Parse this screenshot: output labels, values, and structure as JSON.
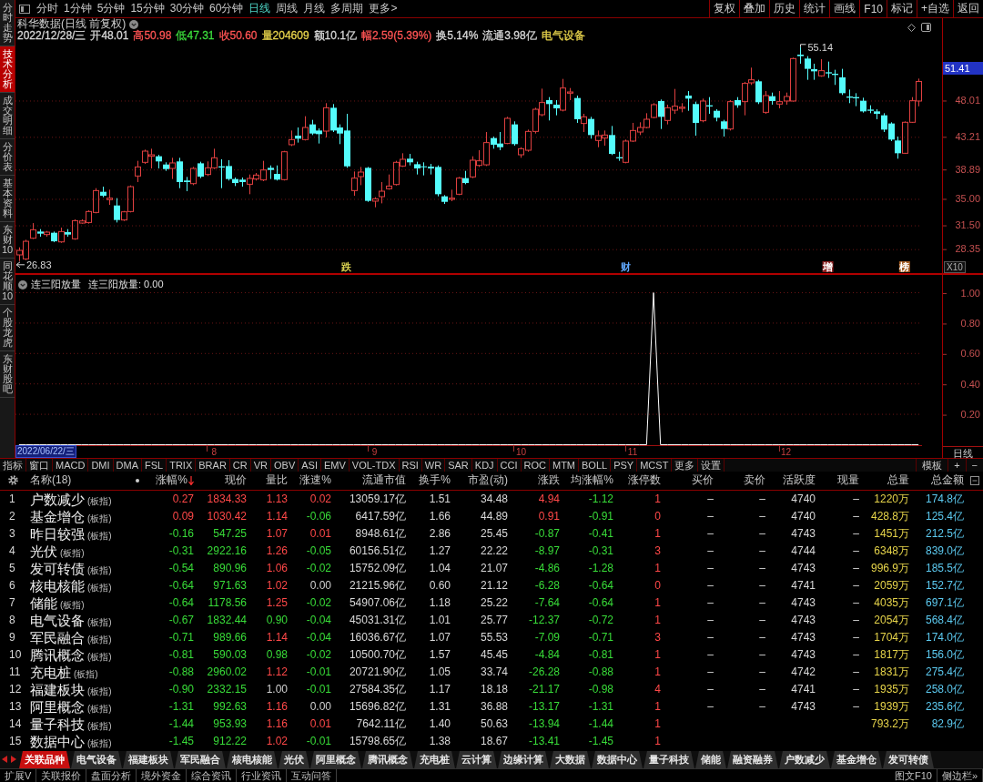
{
  "sidebar": {
    "items": [
      {
        "label": "分时走势",
        "selected": false
      },
      {
        "label": "技术分析",
        "selected": true
      },
      {
        "label": "成交明细",
        "selected": false
      },
      {
        "label": "分价表",
        "selected": false
      },
      {
        "label": "基本资料",
        "selected": false
      },
      {
        "label": "东财10",
        "selected": false
      },
      {
        "label": "同花顺10",
        "selected": false
      },
      {
        "label": "个股龙虎",
        "selected": false
      },
      {
        "label": "东财股吧",
        "selected": false
      }
    ]
  },
  "toolbar": {
    "periods": [
      {
        "label": "分时",
        "selected": false
      },
      {
        "label": "1分钟",
        "selected": false
      },
      {
        "label": "5分钟",
        "selected": false
      },
      {
        "label": "15分钟",
        "selected": false
      },
      {
        "label": "30分钟",
        "selected": false
      },
      {
        "label": "60分钟",
        "selected": false
      },
      {
        "label": "日线",
        "selected": true
      },
      {
        "label": "周线",
        "selected": false
      },
      {
        "label": "月线",
        "selected": false
      },
      {
        "label": "多周期",
        "selected": false
      },
      {
        "label": "更多>",
        "selected": false
      }
    ],
    "buttons": [
      "复权",
      "叠加",
      "历史",
      "统计",
      "画线",
      "F10",
      "标记",
      "+自选",
      "返回"
    ]
  },
  "stock_header": {
    "title": "科华数据(日线 前复权)",
    "quote": [
      {
        "text": "2022/12/28/三",
        "color": "#d8d8d8"
      },
      {
        "text": "开48.01",
        "color": "#d8d8d8"
      },
      {
        "text": "高50.98",
        "color": "#ff5454"
      },
      {
        "text": "低47.31",
        "color": "#3cdc3c"
      },
      {
        "text": "收50.60",
        "color": "#ff5454"
      },
      {
        "text": "量204609",
        "color": "#e8d44c"
      },
      {
        "text": "额10.1亿",
        "color": "#d8d8d8"
      },
      {
        "text": "幅2.59(5.39%)",
        "color": "#ff5454"
      },
      {
        "text": "换5.14%",
        "color": "#d8d8d8"
      },
      {
        "text": "流通3.98亿",
        "color": "#d8d8d8"
      },
      {
        "text": "电气设备",
        "color": "#e8d44c"
      }
    ]
  },
  "main_chart": {
    "current_price": "51.41",
    "high_label": "55.14",
    "low_label": "26.83",
    "event_marks": [
      {
        "text": "跌",
        "color": "#d8d050",
        "boxed": false
      },
      {
        "text": "财",
        "color": "#60a8ff",
        "boxed": false
      },
      {
        "text": "增",
        "color": "#8b2020",
        "boxed": true
      },
      {
        "text": "榜",
        "color": "#a05a20",
        "boxed": true
      }
    ],
    "zoom_button": "X10",
    "chart_data": {
      "type": "candlestick",
      "categories": [
        null,
        null,
        null,
        null,
        null,
        null,
        null,
        null,
        null,
        null,
        null,
        null,
        null,
        null,
        null,
        null,
        null,
        null,
        null,
        null,
        null,
        null,
        null,
        null,
        null,
        null,
        null,
        null,
        null,
        null,
        null,
        null,
        null,
        null,
        null,
        null,
        null,
        null,
        null,
        null,
        null,
        null,
        null,
        null,
        null,
        null,
        null,
        null,
        null,
        null,
        null,
        null,
        null,
        null,
        null,
        null,
        null,
        null,
        null,
        null,
        null,
        null,
        null,
        null,
        null,
        null,
        null,
        null,
        null,
        null,
        null,
        null,
        null,
        null,
        null,
        null,
        null,
        null,
        null,
        null,
        null,
        null,
        null,
        null,
        null,
        null,
        null,
        null,
        null,
        null,
        null,
        null,
        null,
        null,
        null,
        null,
        null,
        null,
        null,
        null,
        null,
        null,
        null,
        null,
        null,
        null,
        null,
        null,
        null,
        null,
        null,
        null,
        null,
        null,
        null,
        null,
        null,
        null,
        null,
        null,
        null,
        null,
        null,
        null,
        null,
        null,
        null,
        null,
        null,
        null
      ],
      "ohlc": [
        [
          27.65,
          28.65,
          26.83,
          28.25
        ],
        [
          27.12,
          29.65,
          26.96,
          29.45
        ],
        [
          29.86,
          31.86,
          29.76,
          30.98
        ],
        [
          30.74,
          31.06,
          30.06,
          30.46
        ],
        [
          30.34,
          30.82,
          30.06,
          30.66
        ],
        [
          30.58,
          30.74,
          29.33,
          29.45
        ],
        [
          29.37,
          31.26,
          29.25,
          30.74
        ],
        [
          30.66,
          31.06,
          30.06,
          30.34
        ],
        [
          29.78,
          32.35,
          29.65,
          32.18
        ],
        [
          31.86,
          32.35,
          31.78,
          32.14
        ],
        [
          31.94,
          33.55,
          31.78,
          33.39
        ],
        [
          33.27,
          36.48,
          33.15,
          36.16
        ],
        [
          36.0,
          36.68,
          35.28,
          35.48
        ],
        [
          34.96,
          36.28,
          34.27,
          35.16
        ],
        [
          34.19,
          35.16,
          31.94,
          32.27
        ],
        [
          32.27,
          33.47,
          32.14,
          33.35
        ],
        [
          33.39,
          36.84,
          33.27,
          36.68
        ],
        [
          38.09,
          40.1,
          37.29,
          39.29
        ],
        [
          39.9,
          41.58,
          39.69,
          41.38
        ],
        [
          40.7,
          41.7,
          39.09,
          40.9
        ],
        [
          40.7,
          40.9,
          39.09,
          40.02
        ],
        [
          39.61,
          39.9,
          38.77,
          39.01
        ],
        [
          39.09,
          40.5,
          37.69,
          39.82
        ],
        [
          40.02,
          40.5,
          36.48,
          37.29
        ],
        [
          37.49,
          37.97,
          36.08,
          37.29
        ],
        [
          37.08,
          39.29,
          36.88,
          39.09
        ],
        [
          39.77,
          39.98,
          37.81,
          38.01
        ],
        [
          38.29,
          40.02,
          38.09,
          39.17
        ],
        [
          39.17,
          41.7,
          39.01,
          40.5
        ],
        [
          39.37,
          40.3,
          36.48,
          39.21
        ],
        [
          39.41,
          40.18,
          37.49,
          37.69
        ],
        [
          37.69,
          37.89,
          36.76,
          37.16
        ],
        [
          37.61,
          37.89,
          36.68,
          37.29
        ],
        [
          37.0,
          38.29,
          35.68,
          37.77
        ],
        [
          37.69,
          38.49,
          37.49,
          38.21
        ],
        [
          37.57,
          40.1,
          37.41,
          38.89
        ],
        [
          39.17,
          39.49,
          37.69,
          38.89
        ],
        [
          38.37,
          39.49,
          37.49,
          37.61
        ],
        [
          37.61,
          41.42,
          37.49,
          41.3
        ],
        [
          42.23,
          44.11,
          42.06,
          42.91
        ],
        [
          43.43,
          44.51,
          42.51,
          43.03
        ],
        [
          42.91,
          46.0,
          42.79,
          44.51
        ],
        [
          44.92,
          45.52,
          43.51,
          43.71
        ],
        [
          44.11,
          44.39,
          42.39,
          43.63
        ],
        [
          44.03,
          47.73,
          43.19,
          47.12
        ],
        [
          47.12,
          47.61,
          43.91,
          44.11
        ],
        [
          44.51,
          44.92,
          42.31,
          43.71
        ],
        [
          44.11,
          46.32,
          39.17,
          39.37
        ],
        [
          36.16,
          38.69,
          35.48,
          37.81
        ],
        [
          38.01,
          39.29,
          36.88,
          38.61
        ],
        [
          39.17,
          39.29,
          34.67,
          34.8
        ],
        [
          34.76,
          35.28,
          33.95,
          35.08
        ],
        [
          35.36,
          37.29,
          34.47,
          36.08
        ],
        [
          36.4,
          38.29,
          36.28,
          36.76
        ],
        [
          36.96,
          40.1,
          36.84,
          39.9
        ],
        [
          39.41,
          41.1,
          39.29,
          40.3
        ],
        [
          40.38,
          41.02,
          39.49,
          39.9
        ],
        [
          39.65,
          39.98,
          38.29,
          39.09
        ],
        [
          39.37,
          39.9,
          38.17,
          39.29
        ],
        [
          39.33,
          39.69,
          38.29,
          39.09
        ],
        [
          39.29,
          39.49,
          35.4,
          35.68
        ],
        [
          35.4,
          35.56,
          34.39,
          34.67
        ],
        [
          35.0,
          36.28,
          34.76,
          35.16
        ],
        [
          35.68,
          37.97,
          35.56,
          37.81
        ],
        [
          37.81,
          38.77,
          37.0,
          37.16
        ],
        [
          37.97,
          40.7,
          37.81,
          40.18
        ],
        [
          39.49,
          41.5,
          39.29,
          40.1
        ],
        [
          39.57,
          43.91,
          39.41,
          42.51
        ],
        [
          43.11,
          43.31,
          41.7,
          42.23
        ],
        [
          42.39,
          43.91,
          41.5,
          41.9
        ],
        [
          42.39,
          45.92,
          42.31,
          45.72
        ],
        [
          44.92,
          45.32,
          42.1,
          42.31
        ],
        [
          40.9,
          41.9,
          40.5,
          41.7
        ],
        [
          41.5,
          44.23,
          41.3,
          43.99
        ],
        [
          43.99,
          47.12,
          43.71,
          46.92
        ],
        [
          46.2,
          49.65,
          46.0,
          47.81
        ],
        [
          48.13,
          48.53,
          45.44,
          47.61
        ],
        [
          47.53,
          48.13,
          46.12,
          47.04
        ],
        [
          46.8,
          50.94,
          46.64,
          49.73
        ],
        [
          49.05,
          49.73,
          48.13,
          49.21
        ],
        [
          48.41,
          48.73,
          45.12,
          45.6
        ],
        [
          45.04,
          46.32,
          43.91,
          45.92
        ],
        [
          45.64,
          45.92,
          43.03,
          43.51
        ],
        [
          42.79,
          44.11,
          41.9,
          43.43
        ],
        [
          43.11,
          44.11,
          42.1,
          43.51
        ],
        [
          43.51,
          44.71,
          40.86,
          41.02
        ],
        [
          40.58,
          41.3,
          40.1,
          40.42
        ],
        [
          39.9,
          42.91,
          39.77,
          42.71
        ],
        [
          42.71,
          45.12,
          42.59,
          44.11
        ],
        [
          43.91,
          45.2,
          43.51,
          44.51
        ],
        [
          44.51,
          46.4,
          44.39,
          45.6
        ],
        [
          45.84,
          47.73,
          45.72,
          47.53
        ],
        [
          48.01,
          48.21,
          44.31,
          45.92
        ],
        [
          45.44,
          47.53,
          44.92,
          47.12
        ],
        [
          46.8,
          49.61,
          46.32,
          47.33
        ],
        [
          47.04,
          47.73,
          46.52,
          47.2
        ],
        [
          48.73,
          49.33,
          46.72,
          48.33
        ],
        [
          47.61,
          47.93,
          43.43,
          45.12
        ],
        [
          45.4,
          48.33,
          45.2,
          48.01
        ],
        [
          47.45,
          48.53,
          46.32,
          47.29
        ],
        [
          46.72,
          46.92,
          45.32,
          45.8
        ],
        [
          45.32,
          45.52,
          43.31,
          44.31
        ],
        [
          44.31,
          48.13,
          44.11,
          47.93
        ],
        [
          48.13,
          48.53,
          47.12,
          47.45
        ],
        [
          47.93,
          50.54,
          46.12,
          50.34
        ],
        [
          50.42,
          52.43,
          50.14,
          50.82
        ],
        [
          50.62,
          50.82,
          47.61,
          47.85
        ],
        [
          46.52,
          49.33,
          46.32,
          48.73
        ],
        [
          48.65,
          49.13,
          47.53,
          48.01
        ],
        [
          47.61,
          49.33,
          47.04,
          47.93
        ],
        [
          48.01,
          49.13,
          47.53,
          48.61
        ],
        [
          48.01,
          53.75,
          47.93,
          53.63
        ],
        [
          54.15,
          55.14,
          52.95,
          53.95
        ],
        [
          53.63,
          53.95,
          50.82,
          52.27
        ],
        [
          52.23,
          52.95,
          50.82,
          51.94
        ],
        [
          51.34,
          53.55,
          51.22,
          52.03
        ],
        [
          51.82,
          53.23,
          51.06,
          51.66
        ],
        [
          51.62,
          52.15,
          50.14,
          51.46
        ],
        [
          51.14,
          52.27,
          48.81,
          49.05
        ],
        [
          48.61,
          49.53,
          47.73,
          48.45
        ],
        [
          48.53,
          49.05,
          47.33,
          48.37
        ],
        [
          48.05,
          48.45,
          46.48,
          46.64
        ],
        [
          46.88,
          47.45,
          46.4,
          46.72
        ],
        [
          46.64,
          46.92,
          45.6,
          46.32
        ],
        [
          46.12,
          46.4,
          43.91,
          44.23
        ],
        [
          45.04,
          45.2,
          42.71,
          42.91
        ],
        [
          42.79,
          43.31,
          40.38,
          41.1
        ],
        [
          41.1,
          45.32,
          41.02,
          45.2
        ],
        [
          45.2,
          48.53,
          45.12,
          48.05
        ],
        [
          48.01,
          50.98,
          47.31,
          50.6
        ]
      ],
      "ylim": [
        25.12,
        58.97
      ],
      "yticks": [
        {
          "value": 48.01,
          "label": "48.01"
        },
        {
          "value": 43.21,
          "label": "43.21"
        },
        {
          "value": 38.89,
          "label": "38.89"
        },
        {
          "value": 35,
          "label": "35.00"
        },
        {
          "value": 31.5,
          "label": "31.50"
        },
        {
          "value": 28.35,
          "label": "28.35"
        }
      ],
      "grid": true
    }
  },
  "indicator": {
    "legend": "连三阳放量: 0.00",
    "cursor_date": "2022/06/22/三",
    "period_label": "日线",
    "chart_data": {
      "type": "line",
      "title": "连三阳放量",
      "categories": [
        null,
        null,
        null,
        null,
        null,
        null,
        null,
        null,
        null,
        null,
        null,
        null,
        null,
        null,
        null,
        null,
        null,
        null,
        null,
        null,
        null,
        null,
        null,
        null,
        null,
        null,
        null,
        null,
        "8",
        null,
        null,
        null,
        null,
        null,
        null,
        null,
        null,
        null,
        null,
        null,
        null,
        null,
        null,
        null,
        null,
        null,
        null,
        null,
        null,
        null,
        null,
        "9",
        null,
        null,
        null,
        null,
        null,
        null,
        null,
        null,
        null,
        null,
        null,
        null,
        null,
        null,
        null,
        null,
        null,
        null,
        null,
        null,
        "10",
        null,
        null,
        null,
        null,
        null,
        null,
        null,
        null,
        null,
        null,
        null,
        null,
        null,
        null,
        null,
        "11",
        null,
        null,
        null,
        null,
        null,
        null,
        null,
        null,
        null,
        null,
        null,
        null,
        null,
        null,
        null,
        null,
        null,
        null,
        null,
        null,
        null,
        "12",
        null,
        null,
        null,
        null,
        null,
        null,
        null,
        null,
        null,
        null,
        null,
        null,
        null,
        null,
        null,
        null,
        null,
        null,
        null
      ],
      "ylim": [
        -0.087,
        1.123
      ],
      "yticks": [
        {
          "value": 1,
          "label": "1.00"
        },
        {
          "value": 0.8,
          "label": "0.80"
        },
        {
          "value": 0.6,
          "label": "0.60"
        },
        {
          "value": 0.4,
          "label": "0.40"
        },
        {
          "value": 0.2,
          "label": "0.20"
        }
      ],
      "grid": true,
      "series": [
        {
          "color": "#ffffff",
          "values": [
            0,
            0,
            0,
            0,
            0,
            0,
            0,
            0,
            0,
            0,
            0,
            0,
            0,
            0,
            0,
            0,
            0,
            0,
            0,
            0,
            0,
            0,
            0,
            0,
            0,
            0,
            0,
            0,
            0,
            0,
            0,
            0,
            0,
            0,
            0,
            0,
            0,
            0,
            0,
            0,
            0,
            0,
            0,
            0,
            0,
            0,
            0,
            0,
            0,
            0,
            0,
            0,
            0,
            0,
            0,
            0,
            0,
            0,
            0,
            0,
            0,
            0,
            0,
            0,
            0,
            0,
            0,
            0,
            0,
            0,
            0,
            0,
            0,
            0,
            0,
            0,
            0,
            0,
            0,
            0,
            0,
            0,
            0,
            0,
            0,
            0,
            0,
            0,
            0,
            0,
            0,
            1,
            0,
            0,
            0,
            0,
            0,
            0,
            0,
            0,
            0,
            0,
            0,
            0,
            0,
            0,
            0,
            0,
            0,
            0,
            0,
            0,
            0,
            0,
            0,
            0,
            0,
            0,
            0,
            0,
            0,
            0,
            0,
            0,
            0,
            0,
            0,
            0,
            0,
            0
          ]
        }
      ]
    }
  },
  "indicator_bar": {
    "tabs": [
      "指标",
      "窗口",
      "MACD",
      "DMI",
      "DMA",
      "FSL",
      "TRIX",
      "BRAR",
      "CR",
      "VR",
      "OBV",
      "ASI",
      "EMV",
      "VOL-TDX",
      "RSI",
      "WR",
      "SAR",
      "KDJ",
      "CCI",
      "ROC",
      "MTM",
      "BOLL",
      "PSY",
      "MCST",
      "更多",
      "设置"
    ],
    "tools": [
      "模板",
      "+",
      "−"
    ]
  },
  "table": {
    "columns": [
      {
        "label": "名称(18)",
        "sorted": false
      },
      {
        "label": "涨幅%",
        "sorted": true
      },
      {
        "label": "现价",
        "sorted": false
      },
      {
        "label": "量比",
        "sorted": false
      },
      {
        "label": "涨速%",
        "sorted": false
      },
      {
        "label": "流通市值",
        "sorted": false
      },
      {
        "label": "换手%",
        "sorted": false
      },
      {
        "label": "市盈(动)",
        "sorted": false
      },
      {
        "label": "涨跌",
        "sorted": false
      },
      {
        "label": "均涨幅%",
        "sorted": false
      },
      {
        "label": "涨停数",
        "sorted": false
      },
      {
        "label": "买价",
        "sorted": false
      },
      {
        "label": "卖价",
        "sorted": false
      },
      {
        "label": "活跃度",
        "sorted": false
      },
      {
        "label": "现量",
        "sorted": false
      },
      {
        "label": "总量",
        "sorted": false
      },
      {
        "label": "总金额",
        "sorted": false
      }
    ],
    "rows": [
      {
        "no": "1",
        "name": "户数减少",
        "tag": "(板指)",
        "change_pct": {
          "text": "0.27",
          "color": "#ff4848"
        },
        "price": {
          "text": "1834.33",
          "color": "#ff4848"
        },
        "volume_ratio": {
          "text": "1.13",
          "color": "#ff4848"
        },
        "speed": {
          "text": "0.02",
          "color": "#ff4848"
        },
        "float_value": "13059.17亿",
        "turnover": "1.51",
        "pe": "34.48",
        "change": {
          "text": "4.94",
          "color": "#ff4848"
        },
        "avg_change": {
          "text": "-1.12",
          "color": "#38dc38"
        },
        "limit_ups": "1",
        "bid": "–",
        "ask": "–",
        "activity": "4740",
        "last_volume": "–",
        "volume": "1220万",
        "amount": "174.8亿"
      },
      {
        "no": "2",
        "name": "基金增仓",
        "tag": "(板指)",
        "change_pct": {
          "text": "0.09",
          "color": "#ff4848"
        },
        "price": {
          "text": "1030.42",
          "color": "#ff4848"
        },
        "volume_ratio": {
          "text": "1.14",
          "color": "#ff4848"
        },
        "speed": {
          "text": "-0.06",
          "color": "#38dc38"
        },
        "float_value": "6417.59亿",
        "turnover": "1.66",
        "pe": "44.89",
        "change": {
          "text": "0.91",
          "color": "#ff4848"
        },
        "avg_change": {
          "text": "-0.91",
          "color": "#38dc38"
        },
        "limit_ups": "0",
        "bid": "–",
        "ask": "–",
        "activity": "4740",
        "last_volume": "–",
        "volume": "428.8万",
        "amount": "125.4亿"
      },
      {
        "no": "3",
        "name": "昨日较强",
        "tag": "(板指)",
        "change_pct": {
          "text": "-0.16",
          "color": "#38dc38"
        },
        "price": {
          "text": "547.25",
          "color": "#38dc38"
        },
        "volume_ratio": {
          "text": "1.07",
          "color": "#ff4848"
        },
        "speed": {
          "text": "0.01",
          "color": "#ff4848"
        },
        "float_value": "8948.61亿",
        "turnover": "2.86",
        "pe": "25.45",
        "change": {
          "text": "-0.87",
          "color": "#38dc38"
        },
        "avg_change": {
          "text": "-0.41",
          "color": "#38dc38"
        },
        "limit_ups": "1",
        "bid": "–",
        "ask": "–",
        "activity": "4743",
        "last_volume": "–",
        "volume": "1451万",
        "amount": "212.5亿"
      },
      {
        "no": "4",
        "name": "光伏",
        "tag": "(板指)",
        "change_pct": {
          "text": "-0.31",
          "color": "#38dc38"
        },
        "price": {
          "text": "2922.16",
          "color": "#38dc38"
        },
        "volume_ratio": {
          "text": "1.26",
          "color": "#ff4848"
        },
        "speed": {
          "text": "-0.05",
          "color": "#38dc38"
        },
        "float_value": "60156.51亿",
        "turnover": "1.27",
        "pe": "22.22",
        "change": {
          "text": "-8.97",
          "color": "#38dc38"
        },
        "avg_change": {
          "text": "-0.31",
          "color": "#38dc38"
        },
        "limit_ups": "3",
        "bid": "–",
        "ask": "–",
        "activity": "4744",
        "last_volume": "–",
        "volume": "6348万",
        "amount": "839.0亿"
      },
      {
        "no": "5",
        "name": "发可转债",
        "tag": "(板指)",
        "change_pct": {
          "text": "-0.54",
          "color": "#38dc38"
        },
        "price": {
          "text": "890.96",
          "color": "#38dc38"
        },
        "volume_ratio": {
          "text": "1.06",
          "color": "#ff4848"
        },
        "speed": {
          "text": "-0.02",
          "color": "#38dc38"
        },
        "float_value": "15752.09亿",
        "turnover": "1.04",
        "pe": "21.07",
        "change": {
          "text": "-4.86",
          "color": "#38dc38"
        },
        "avg_change": {
          "text": "-1.28",
          "color": "#38dc38"
        },
        "limit_ups": "1",
        "bid": "–",
        "ask": "–",
        "activity": "4743",
        "last_volume": "–",
        "volume": "996.9万",
        "amount": "185.5亿"
      },
      {
        "no": "6",
        "name": "核电核能",
        "tag": "(板指)",
        "change_pct": {
          "text": "-0.64",
          "color": "#38dc38"
        },
        "price": {
          "text": "971.63",
          "color": "#38dc38"
        },
        "volume_ratio": {
          "text": "1.02",
          "color": "#ff4848"
        },
        "speed": {
          "text": "0.00",
          "color": "#d0d0d0"
        },
        "float_value": "21215.96亿",
        "turnover": "0.60",
        "pe": "21.12",
        "change": {
          "text": "-6.28",
          "color": "#38dc38"
        },
        "avg_change": {
          "text": "-0.64",
          "color": "#38dc38"
        },
        "limit_ups": "0",
        "bid": "–",
        "ask": "–",
        "activity": "4741",
        "last_volume": "–",
        "volume": "2059万",
        "amount": "152.7亿"
      },
      {
        "no": "7",
        "name": "储能",
        "tag": "(板指)",
        "change_pct": {
          "text": "-0.64",
          "color": "#38dc38"
        },
        "price": {
          "text": "1178.56",
          "color": "#38dc38"
        },
        "volume_ratio": {
          "text": "1.25",
          "color": "#ff4848"
        },
        "speed": {
          "text": "-0.02",
          "color": "#38dc38"
        },
        "float_value": "54907.06亿",
        "turnover": "1.18",
        "pe": "25.22",
        "change": {
          "text": "-7.64",
          "color": "#38dc38"
        },
        "avg_change": {
          "text": "-0.64",
          "color": "#38dc38"
        },
        "limit_ups": "1",
        "bid": "–",
        "ask": "–",
        "activity": "4743",
        "last_volume": "–",
        "volume": "4035万",
        "amount": "697.1亿"
      },
      {
        "no": "8",
        "name": "电气设备",
        "tag": "(板指)",
        "change_pct": {
          "text": "-0.67",
          "color": "#38dc38"
        },
        "price": {
          "text": "1832.44",
          "color": "#38dc38"
        },
        "volume_ratio": {
          "text": "0.90",
          "color": "#38dc38"
        },
        "speed": {
          "text": "-0.04",
          "color": "#38dc38"
        },
        "float_value": "45031.31亿",
        "turnover": "1.01",
        "pe": "25.77",
        "change": {
          "text": "-12.37",
          "color": "#38dc38"
        },
        "avg_change": {
          "text": "-0.72",
          "color": "#38dc38"
        },
        "limit_ups": "1",
        "bid": "–",
        "ask": "–",
        "activity": "4743",
        "last_volume": "–",
        "volume": "2054万",
        "amount": "568.4亿"
      },
      {
        "no": "9",
        "name": "军民融合",
        "tag": "(板指)",
        "change_pct": {
          "text": "-0.71",
          "color": "#38dc38"
        },
        "price": {
          "text": "989.66",
          "color": "#38dc38"
        },
        "volume_ratio": {
          "text": "1.14",
          "color": "#ff4848"
        },
        "speed": {
          "text": "-0.04",
          "color": "#38dc38"
        },
        "float_value": "16036.67亿",
        "turnover": "1.07",
        "pe": "55.53",
        "change": {
          "text": "-7.09",
          "color": "#38dc38"
        },
        "avg_change": {
          "text": "-0.71",
          "color": "#38dc38"
        },
        "limit_ups": "3",
        "bid": "–",
        "ask": "–",
        "activity": "4743",
        "last_volume": "–",
        "volume": "1704万",
        "amount": "174.0亿"
      },
      {
        "no": "10",
        "name": "腾讯概念",
        "tag": "(板指)",
        "change_pct": {
          "text": "-0.81",
          "color": "#38dc38"
        },
        "price": {
          "text": "590.03",
          "color": "#38dc38"
        },
        "volume_ratio": {
          "text": "0.98",
          "color": "#38dc38"
        },
        "speed": {
          "text": "-0.02",
          "color": "#38dc38"
        },
        "float_value": "10500.70亿",
        "turnover": "1.57",
        "pe": "45.45",
        "change": {
          "text": "-4.84",
          "color": "#38dc38"
        },
        "avg_change": {
          "text": "-0.81",
          "color": "#38dc38"
        },
        "limit_ups": "1",
        "bid": "–",
        "ask": "–",
        "activity": "4743",
        "last_volume": "–",
        "volume": "1817万",
        "amount": "156.0亿"
      },
      {
        "no": "11",
        "name": "充电桩",
        "tag": "(板指)",
        "change_pct": {
          "text": "-0.88",
          "color": "#38dc38"
        },
        "price": {
          "text": "2960.02",
          "color": "#38dc38"
        },
        "volume_ratio": {
          "text": "1.12",
          "color": "#ff4848"
        },
        "speed": {
          "text": "-0.01",
          "color": "#38dc38"
        },
        "float_value": "20721.90亿",
        "turnover": "1.05",
        "pe": "33.74",
        "change": {
          "text": "-26.28",
          "color": "#38dc38"
        },
        "avg_change": {
          "text": "-0.88",
          "color": "#38dc38"
        },
        "limit_ups": "1",
        "bid": "–",
        "ask": "–",
        "activity": "4742",
        "last_volume": "–",
        "volume": "1831万",
        "amount": "275.4亿"
      },
      {
        "no": "12",
        "name": "福建板块",
        "tag": "(板指)",
        "change_pct": {
          "text": "-0.90",
          "color": "#38dc38"
        },
        "price": {
          "text": "2332.15",
          "color": "#38dc38"
        },
        "volume_ratio": {
          "text": "1.00",
          "color": "#d0d0d0"
        },
        "speed": {
          "text": "-0.01",
          "color": "#38dc38"
        },
        "float_value": "27584.35亿",
        "turnover": "1.17",
        "pe": "18.18",
        "change": {
          "text": "-21.17",
          "color": "#38dc38"
        },
        "avg_change": {
          "text": "-0.98",
          "color": "#38dc38"
        },
        "limit_ups": "4",
        "bid": "–",
        "ask": "–",
        "activity": "4741",
        "last_volume": "–",
        "volume": "1935万",
        "amount": "258.0亿"
      },
      {
        "no": "13",
        "name": "阿里概念",
        "tag": "(板指)",
        "change_pct": {
          "text": "-1.31",
          "color": "#38dc38"
        },
        "price": {
          "text": "992.63",
          "color": "#38dc38"
        },
        "volume_ratio": {
          "text": "1.16",
          "color": "#ff4848"
        },
        "speed": {
          "text": "0.00",
          "color": "#d0d0d0"
        },
        "float_value": "15696.82亿",
        "turnover": "1.31",
        "pe": "36.88",
        "change": {
          "text": "-13.17",
          "color": "#38dc38"
        },
        "avg_change": {
          "text": "-1.31",
          "color": "#38dc38"
        },
        "limit_ups": "1",
        "bid": "–",
        "ask": "–",
        "activity": "4743",
        "last_volume": "–",
        "volume": "1939万",
        "amount": "235.6亿"
      },
      {
        "no": "14",
        "name": "量子科技",
        "tag": "(板指)",
        "change_pct": {
          "text": "-1.44",
          "color": "#38dc38"
        },
        "price": {
          "text": "953.93",
          "color": "#38dc38"
        },
        "volume_ratio": {
          "text": "1.16",
          "color": "#ff4848"
        },
        "speed": {
          "text": "0.01",
          "color": "#ff4848"
        },
        "float_value": "7642.11亿",
        "turnover": "1.40",
        "pe": "50.63",
        "change": {
          "text": "-13.94",
          "color": "#38dc38"
        },
        "avg_change": {
          "text": "-1.44",
          "color": "#38dc38"
        },
        "limit_ups": "1",
        "volume": "793.2万",
        "amount": "82.9亿"
      },
      {
        "no": "15",
        "name": "数据中心",
        "tag": "(板指)",
        "change_pct": {
          "text": "-1.45",
          "color": "#38dc38"
        },
        "price": {
          "text": "912.22",
          "color": "#38dc38"
        },
        "volume_ratio": {
          "text": "1.02",
          "color": "#ff4848"
        },
        "speed": {
          "text": "-0.01",
          "color": "#38dc38"
        },
        "float_value": "15798.65亿",
        "turnover": "1.38",
        "pe": "18.67",
        "change": {
          "text": "-13.41",
          "color": "#38dc38"
        },
        "avg_change": {
          "text": "-1.45",
          "color": "#38dc38"
        },
        "limit_ups": "1"
      }
    ]
  },
  "bottom_tabs": [
    {
      "label": "关联品种",
      "selected": true
    },
    {
      "label": "电气设备",
      "selected": false
    },
    {
      "label": "福建板块",
      "selected": false
    },
    {
      "label": "军民融合",
      "selected": false
    },
    {
      "label": "核电核能",
      "selected": false
    },
    {
      "label": "光伏",
      "selected": false
    },
    {
      "label": "阿里概念",
      "selected": false
    },
    {
      "label": "腾讯概念",
      "selected": false
    },
    {
      "label": "充电桩",
      "selected": false
    },
    {
      "label": "云计算",
      "selected": false
    },
    {
      "label": "边缘计算",
      "selected": false
    },
    {
      "label": "大数据",
      "selected": false
    },
    {
      "label": "数据中心",
      "selected": false
    },
    {
      "label": "量子科技",
      "selected": false
    },
    {
      "label": "储能",
      "selected": false
    },
    {
      "label": "融资融券",
      "selected": false
    },
    {
      "label": "户数减少",
      "selected": false
    },
    {
      "label": "基金增仓",
      "selected": false
    },
    {
      "label": "发可转债",
      "selected": false
    }
  ],
  "status_bar": {
    "left": [
      "扩展V",
      "关联报价",
      "盘面分析",
      "境外资金",
      "综合资讯",
      "行业资讯",
      "互动问答"
    ],
    "right": [
      "图文F10",
      "侧边栏»"
    ]
  }
}
